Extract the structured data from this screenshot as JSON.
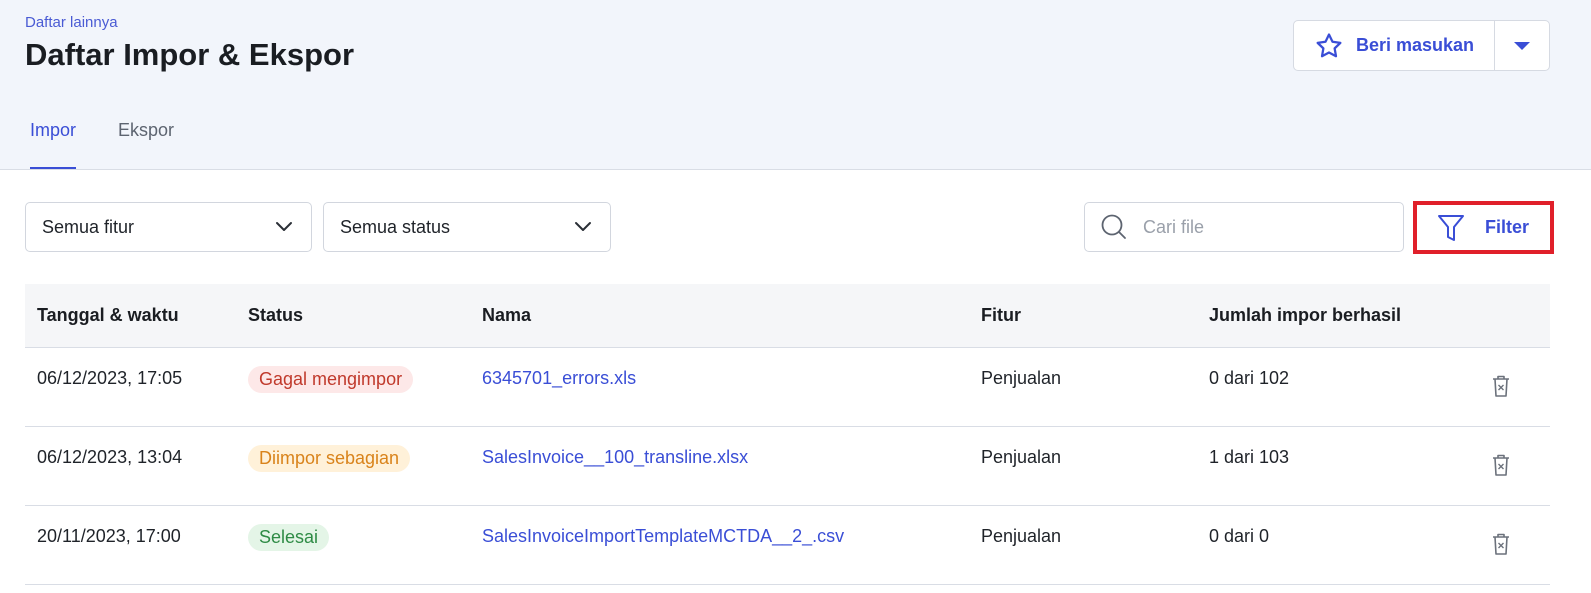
{
  "header": {
    "breadcrumb": "Daftar lainnya",
    "title": "Daftar Impor & Ekspor",
    "feedback_label": "Beri masukan"
  },
  "tabs": [
    {
      "label": "Impor",
      "active": true
    },
    {
      "label": "Ekspor",
      "active": false
    }
  ],
  "filters": {
    "feature_select": "Semua fitur",
    "status_select": "Semua status",
    "search_placeholder": "Cari file",
    "filter_label": "Filter"
  },
  "table": {
    "columns": [
      "Tanggal & waktu",
      "Status",
      "Nama",
      "Fitur",
      "Jumlah impor berhasil"
    ],
    "rows": [
      {
        "datetime": "06/12/2023, 17:05",
        "status": "Gagal mengimpor",
        "status_kind": "fail",
        "name": "6345701_errors.xls",
        "feature": "Penjualan",
        "count": "0 dari 102"
      },
      {
        "datetime": "06/12/2023, 13:04",
        "status": "Diimpor sebagian",
        "status_kind": "partial",
        "name": "SalesInvoice__100_transline.xlsx",
        "feature": "Penjualan",
        "count": "1 dari 103"
      },
      {
        "datetime": "20/11/2023, 17:00",
        "status": "Selesai",
        "status_kind": "done",
        "name": "SalesInvoiceImportTemplateMCTDA__2_.csv",
        "feature": "Penjualan",
        "count": "0 dari 0"
      }
    ]
  },
  "colors": {
    "accent": "#3a4ed6",
    "highlight_border": "#e0202a",
    "header_bg": "#f2f5fb"
  },
  "icons": {
    "feedback": "star-icon",
    "caret": "caret-down-icon",
    "select": "chevron-down-icon",
    "search": "search-icon",
    "filter": "funnel-icon",
    "delete": "trash-icon"
  }
}
